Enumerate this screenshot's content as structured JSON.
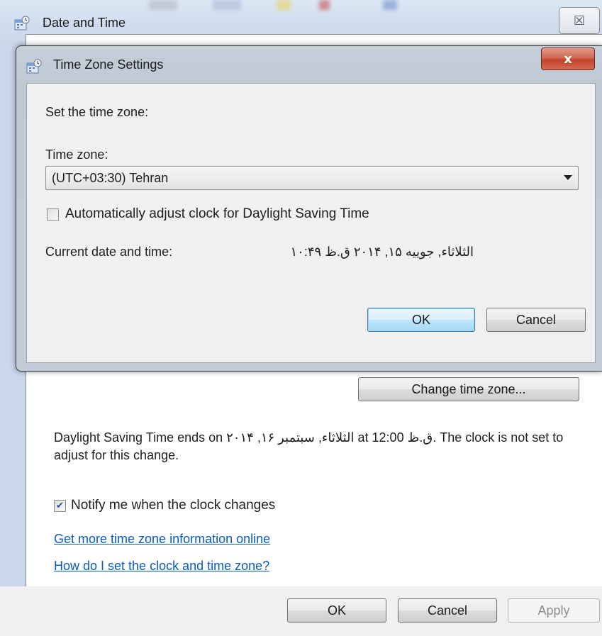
{
  "outer_window": {
    "title": "Date and Time",
    "close_glyph": "☒",
    "change_time_zone_button": "Change time zone...",
    "dst_info_text": "Daylight Saving Time ends on ‏الثلاثاء, سبتمبر ۱۶, ۲۰۱۴‎ at 12:00 ق.ظ. The clock is not set to adjust for this change.",
    "notify_checkbox": {
      "label": "Notify me when the clock changes",
      "checked": true
    },
    "links": [
      "Get more time zone information online",
      "How do I set the clock and time zone?"
    ],
    "footer_buttons": {
      "ok": "OK",
      "cancel": "Cancel",
      "apply": "Apply"
    }
  },
  "dialog": {
    "title": "Time Zone Settings",
    "close_glyph": "x",
    "set_time_zone_label": "Set the time zone:",
    "time_zone_label": "Time zone:",
    "time_zone_value": "(UTC+03:30) Tehran",
    "dst_checkbox": {
      "label": "Automatically adjust clock for Daylight Saving Time",
      "checked": false
    },
    "current_datetime_label": "Current date and time:",
    "current_datetime_value": "الثلاثاء, جوييه ۱۵, ۲۰۱۴ ق.ظ ۱۰:۴۹",
    "ok": "OK",
    "cancel": "Cancel"
  },
  "icons": {
    "outer": "date-time-settings-icon",
    "dialog": "time-zone-settings-icon"
  },
  "colors": {
    "link": "#0b5cbf",
    "close_red": "#c0432d",
    "window_frame": "#c9d7ea",
    "default_button_blue": "#3c7fb1"
  }
}
